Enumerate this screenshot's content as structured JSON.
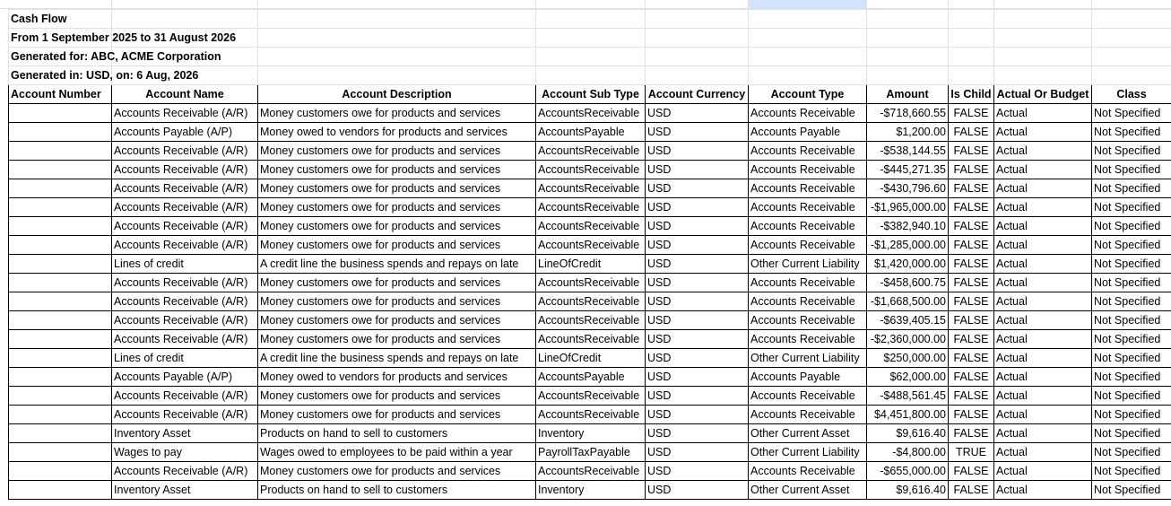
{
  "report": {
    "title": "Cash Flow",
    "period": "From 1 September 2025 to 31 August 2026",
    "generated_for": "Generated for: ABC, ACME Corporation",
    "generated_in": "Generated in: USD, on: 6 Aug, 2026"
  },
  "columns": [
    "Account Number",
    "Account Name",
    "Account Description",
    "Account Sub Type",
    "Account Currency",
    "Account Type",
    "Amount",
    "Is Child",
    "Actual Or Budget",
    "Class"
  ],
  "rows": [
    [
      "",
      "Accounts Receivable (A/R)",
      "Money customers owe for products and services",
      "AccountsReceivable",
      "USD",
      "Accounts Receivable",
      "-$718,660.55",
      "FALSE",
      "Actual",
      "Not Specified"
    ],
    [
      "",
      "Accounts Payable (A/P)",
      "Money owed to vendors for products and services",
      "AccountsPayable",
      "USD",
      "Accounts Payable",
      "$1,200.00",
      "FALSE",
      "Actual",
      "Not Specified"
    ],
    [
      "",
      "Accounts Receivable (A/R)",
      "Money customers owe for products and services",
      "AccountsReceivable",
      "USD",
      "Accounts Receivable",
      "-$538,144.55",
      "FALSE",
      "Actual",
      "Not Specified"
    ],
    [
      "",
      "Accounts Receivable (A/R)",
      "Money customers owe for products and services",
      "AccountsReceivable",
      "USD",
      "Accounts Receivable",
      "-$445,271.35",
      "FALSE",
      "Actual",
      "Not Specified"
    ],
    [
      "",
      "Accounts Receivable (A/R)",
      "Money customers owe for products and services",
      "AccountsReceivable",
      "USD",
      "Accounts Receivable",
      "-$430,796.60",
      "FALSE",
      "Actual",
      "Not Specified"
    ],
    [
      "",
      "Accounts Receivable (A/R)",
      "Money customers owe for products and services",
      "AccountsReceivable",
      "USD",
      "Accounts Receivable",
      "-$1,965,000.00",
      "FALSE",
      "Actual",
      "Not Specified"
    ],
    [
      "",
      "Accounts Receivable (A/R)",
      "Money customers owe for products and services",
      "AccountsReceivable",
      "USD",
      "Accounts Receivable",
      "-$382,940.10",
      "FALSE",
      "Actual",
      "Not Specified"
    ],
    [
      "",
      "Accounts Receivable (A/R)",
      "Money customers owe for products and services",
      "AccountsReceivable",
      "USD",
      "Accounts Receivable",
      "-$1,285,000.00",
      "FALSE",
      "Actual",
      "Not Specified"
    ],
    [
      "",
      "Lines of credit",
      "A credit line the business spends and repays on late",
      "LineOfCredit",
      "USD",
      "Other Current Liability",
      "$1,420,000.00",
      "FALSE",
      "Actual",
      "Not Specified"
    ],
    [
      "",
      "Accounts Receivable (A/R)",
      "Money customers owe for products and services",
      "AccountsReceivable",
      "USD",
      "Accounts Receivable",
      "-$458,600.75",
      "FALSE",
      "Actual",
      "Not Specified"
    ],
    [
      "",
      "Accounts Receivable (A/R)",
      "Money customers owe for products and services",
      "AccountsReceivable",
      "USD",
      "Accounts Receivable",
      "-$1,668,500.00",
      "FALSE",
      "Actual",
      "Not Specified"
    ],
    [
      "",
      "Accounts Receivable (A/R)",
      "Money customers owe for products and services",
      "AccountsReceivable",
      "USD",
      "Accounts Receivable",
      "-$639,405.15",
      "FALSE",
      "Actual",
      "Not Specified"
    ],
    [
      "",
      "Accounts Receivable (A/R)",
      "Money customers owe for products and services",
      "AccountsReceivable",
      "USD",
      "Accounts Receivable",
      "-$2,360,000.00",
      "FALSE",
      "Actual",
      "Not Specified"
    ],
    [
      "",
      "Lines of credit",
      "A credit line the business spends and repays on late",
      "LineOfCredit",
      "USD",
      "Other Current Liability",
      "$250,000.00",
      "FALSE",
      "Actual",
      "Not Specified"
    ],
    [
      "",
      "Accounts Payable (A/P)",
      "Money owed to vendors for products and services",
      "AccountsPayable",
      "USD",
      "Accounts Payable",
      "$62,000.00",
      "FALSE",
      "Actual",
      "Not Specified"
    ],
    [
      "",
      "Accounts Receivable (A/R)",
      "Money customers owe for products and services",
      "AccountsReceivable",
      "USD",
      "Accounts Receivable",
      "-$488,561.45",
      "FALSE",
      "Actual",
      "Not Specified"
    ],
    [
      "",
      "Accounts Receivable (A/R)",
      "Money customers owe for products and services",
      "AccountsReceivable",
      "USD",
      "Accounts Receivable",
      "$4,451,800.00",
      "FALSE",
      "Actual",
      "Not Specified"
    ],
    [
      "",
      "Inventory Asset",
      "Products on hand to sell to customers",
      "Inventory",
      "USD",
      "Other Current Asset",
      "$9,616.40",
      "FALSE",
      "Actual",
      "Not Specified"
    ],
    [
      "",
      "Wages to pay",
      "Wages owed to employees to be paid within a year",
      "PayrollTaxPayable",
      "USD",
      "Other Current Liability",
      "-$4,800.00",
      "TRUE",
      "Actual",
      "Not Specified"
    ],
    [
      "",
      "Accounts Receivable (A/R)",
      "Money customers owe for products and services",
      "AccountsReceivable",
      "USD",
      "Accounts Receivable",
      "-$655,000.00",
      "FALSE",
      "Actual",
      "Not Specified"
    ],
    [
      "",
      "Inventory Asset",
      "Products on hand to sell to customers",
      "Inventory",
      "USD",
      "Other Current Asset",
      "$9,616.40",
      "FALSE",
      "Actual",
      "Not Specified"
    ]
  ]
}
